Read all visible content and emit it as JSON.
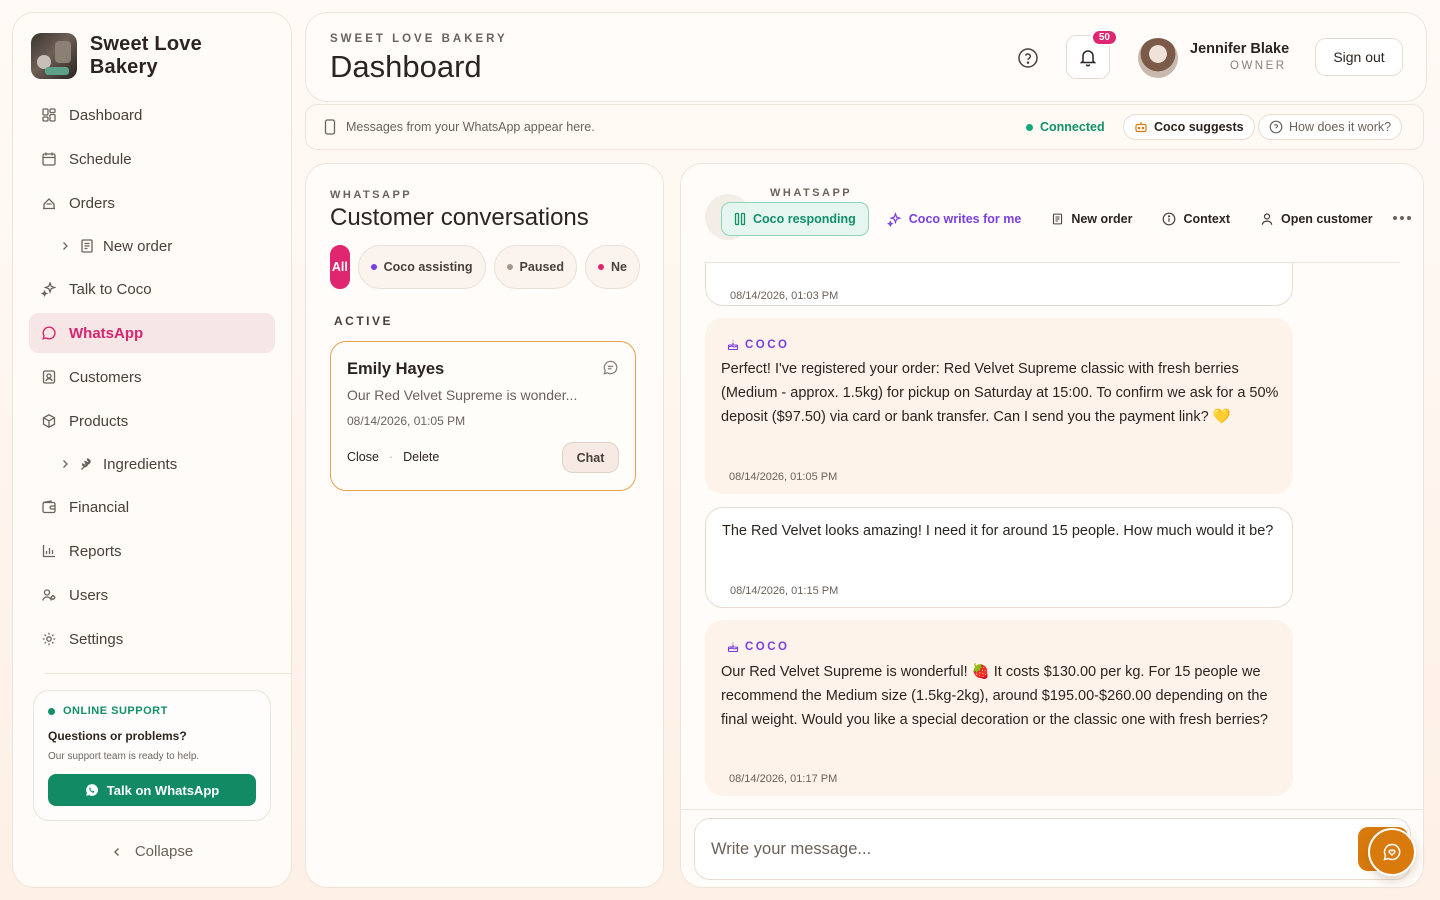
{
  "brand": {
    "name": "Sweet Love Bakery"
  },
  "sidebar": {
    "items": [
      {
        "label": "Dashboard",
        "icon": "dashboard-icon"
      },
      {
        "label": "Schedule",
        "icon": "calendar-icon"
      },
      {
        "label": "Orders",
        "icon": "orders-icon"
      },
      {
        "label": "New order",
        "icon": "document-icon",
        "sub": true
      },
      {
        "label": "Talk to Coco",
        "icon": "sparkle-icon"
      },
      {
        "label": "WhatsApp",
        "icon": "chat-icon",
        "active": true
      },
      {
        "label": "Customers",
        "icon": "contact-icon"
      },
      {
        "label": "Products",
        "icon": "box-icon"
      },
      {
        "label": "Ingredients",
        "icon": "wheat-icon",
        "sub": true
      },
      {
        "label": "Financial",
        "icon": "wallet-icon"
      },
      {
        "label": "Reports",
        "icon": "bar-chart-icon"
      },
      {
        "label": "Users",
        "icon": "users-icon"
      },
      {
        "label": "Settings",
        "icon": "gear-icon"
      }
    ],
    "support": {
      "tag": "ONLINE SUPPORT",
      "title": "Questions or problems?",
      "text": "Our support team is ready to help.",
      "button": "Talk on WhatsApp"
    },
    "collapse": "Collapse"
  },
  "header": {
    "subtitle": "SWEET LOVE BAKERY",
    "title": "Dashboard",
    "notification_count": "50",
    "user_name": "Jennifer Blake",
    "user_role": "OWNER",
    "sign_out": "Sign out"
  },
  "infobar": {
    "text": "Messages from your WhatsApp appear here.",
    "status": "Connected",
    "coco_suggests": "Coco suggests",
    "how": "How does it work?"
  },
  "conversations": {
    "subtitle": "WHATSAPP",
    "title": "Customer conversations",
    "filters": [
      {
        "label": "All"
      },
      {
        "label": "Coco assisting",
        "dot": "#7a3fe0"
      },
      {
        "label": "Paused",
        "dot": "#a39890"
      },
      {
        "label": "Ne",
        "dot": "#e0266f"
      }
    ],
    "active_label": "ACTIVE",
    "card": {
      "name": "Emily Hayes",
      "message": "Our Red Velvet Supreme is wonder...",
      "time": "08/14/2026, 01:05 PM",
      "close": "Close",
      "delete": "Delete",
      "chat": "Chat"
    }
  },
  "chat": {
    "subtitle": "WHATSAPP",
    "toolbar": {
      "responding": "Coco responding",
      "writes": "Coco writes for me",
      "new_order": "New order",
      "context": "Context",
      "open_customer": "Open customer"
    },
    "coco_label": "COCO",
    "messages": [
      {
        "from": "user",
        "text": "",
        "time": "08/14/2026, 01:03 PM"
      },
      {
        "from": "coco",
        "text": "Perfect! I've registered your order: Red Velvet Supreme classic with fresh berries (Medium - approx. 1.5kg) for pickup on Saturday at 15:00. To confirm we ask for a 50% deposit ($97.50) via card or bank transfer. Can I send you the payment link? 💛",
        "time": "08/14/2026, 01:05 PM"
      },
      {
        "from": "user",
        "text": "The Red Velvet looks amazing! I need it for around 15 people. How much would it be?",
        "time": "08/14/2026, 01:15 PM"
      },
      {
        "from": "coco",
        "text": "Our Red Velvet Supreme is wonderful! 🍓 It costs $130.00 per kg. For 15 people we recommend the Medium size (1.5kg-2kg), around $195.00-$260.00 depending on the final weight. Would you like a special decoration or the classic one with fresh berries?",
        "time": "08/14/2026, 01:17 PM"
      }
    ],
    "composer_placeholder": "Write your message..."
  },
  "colors": {
    "accent": "#e0266f",
    "whatsapp_green": "#12906a",
    "coco_purple": "#7a3fe0",
    "orange": "#d97a0c"
  }
}
